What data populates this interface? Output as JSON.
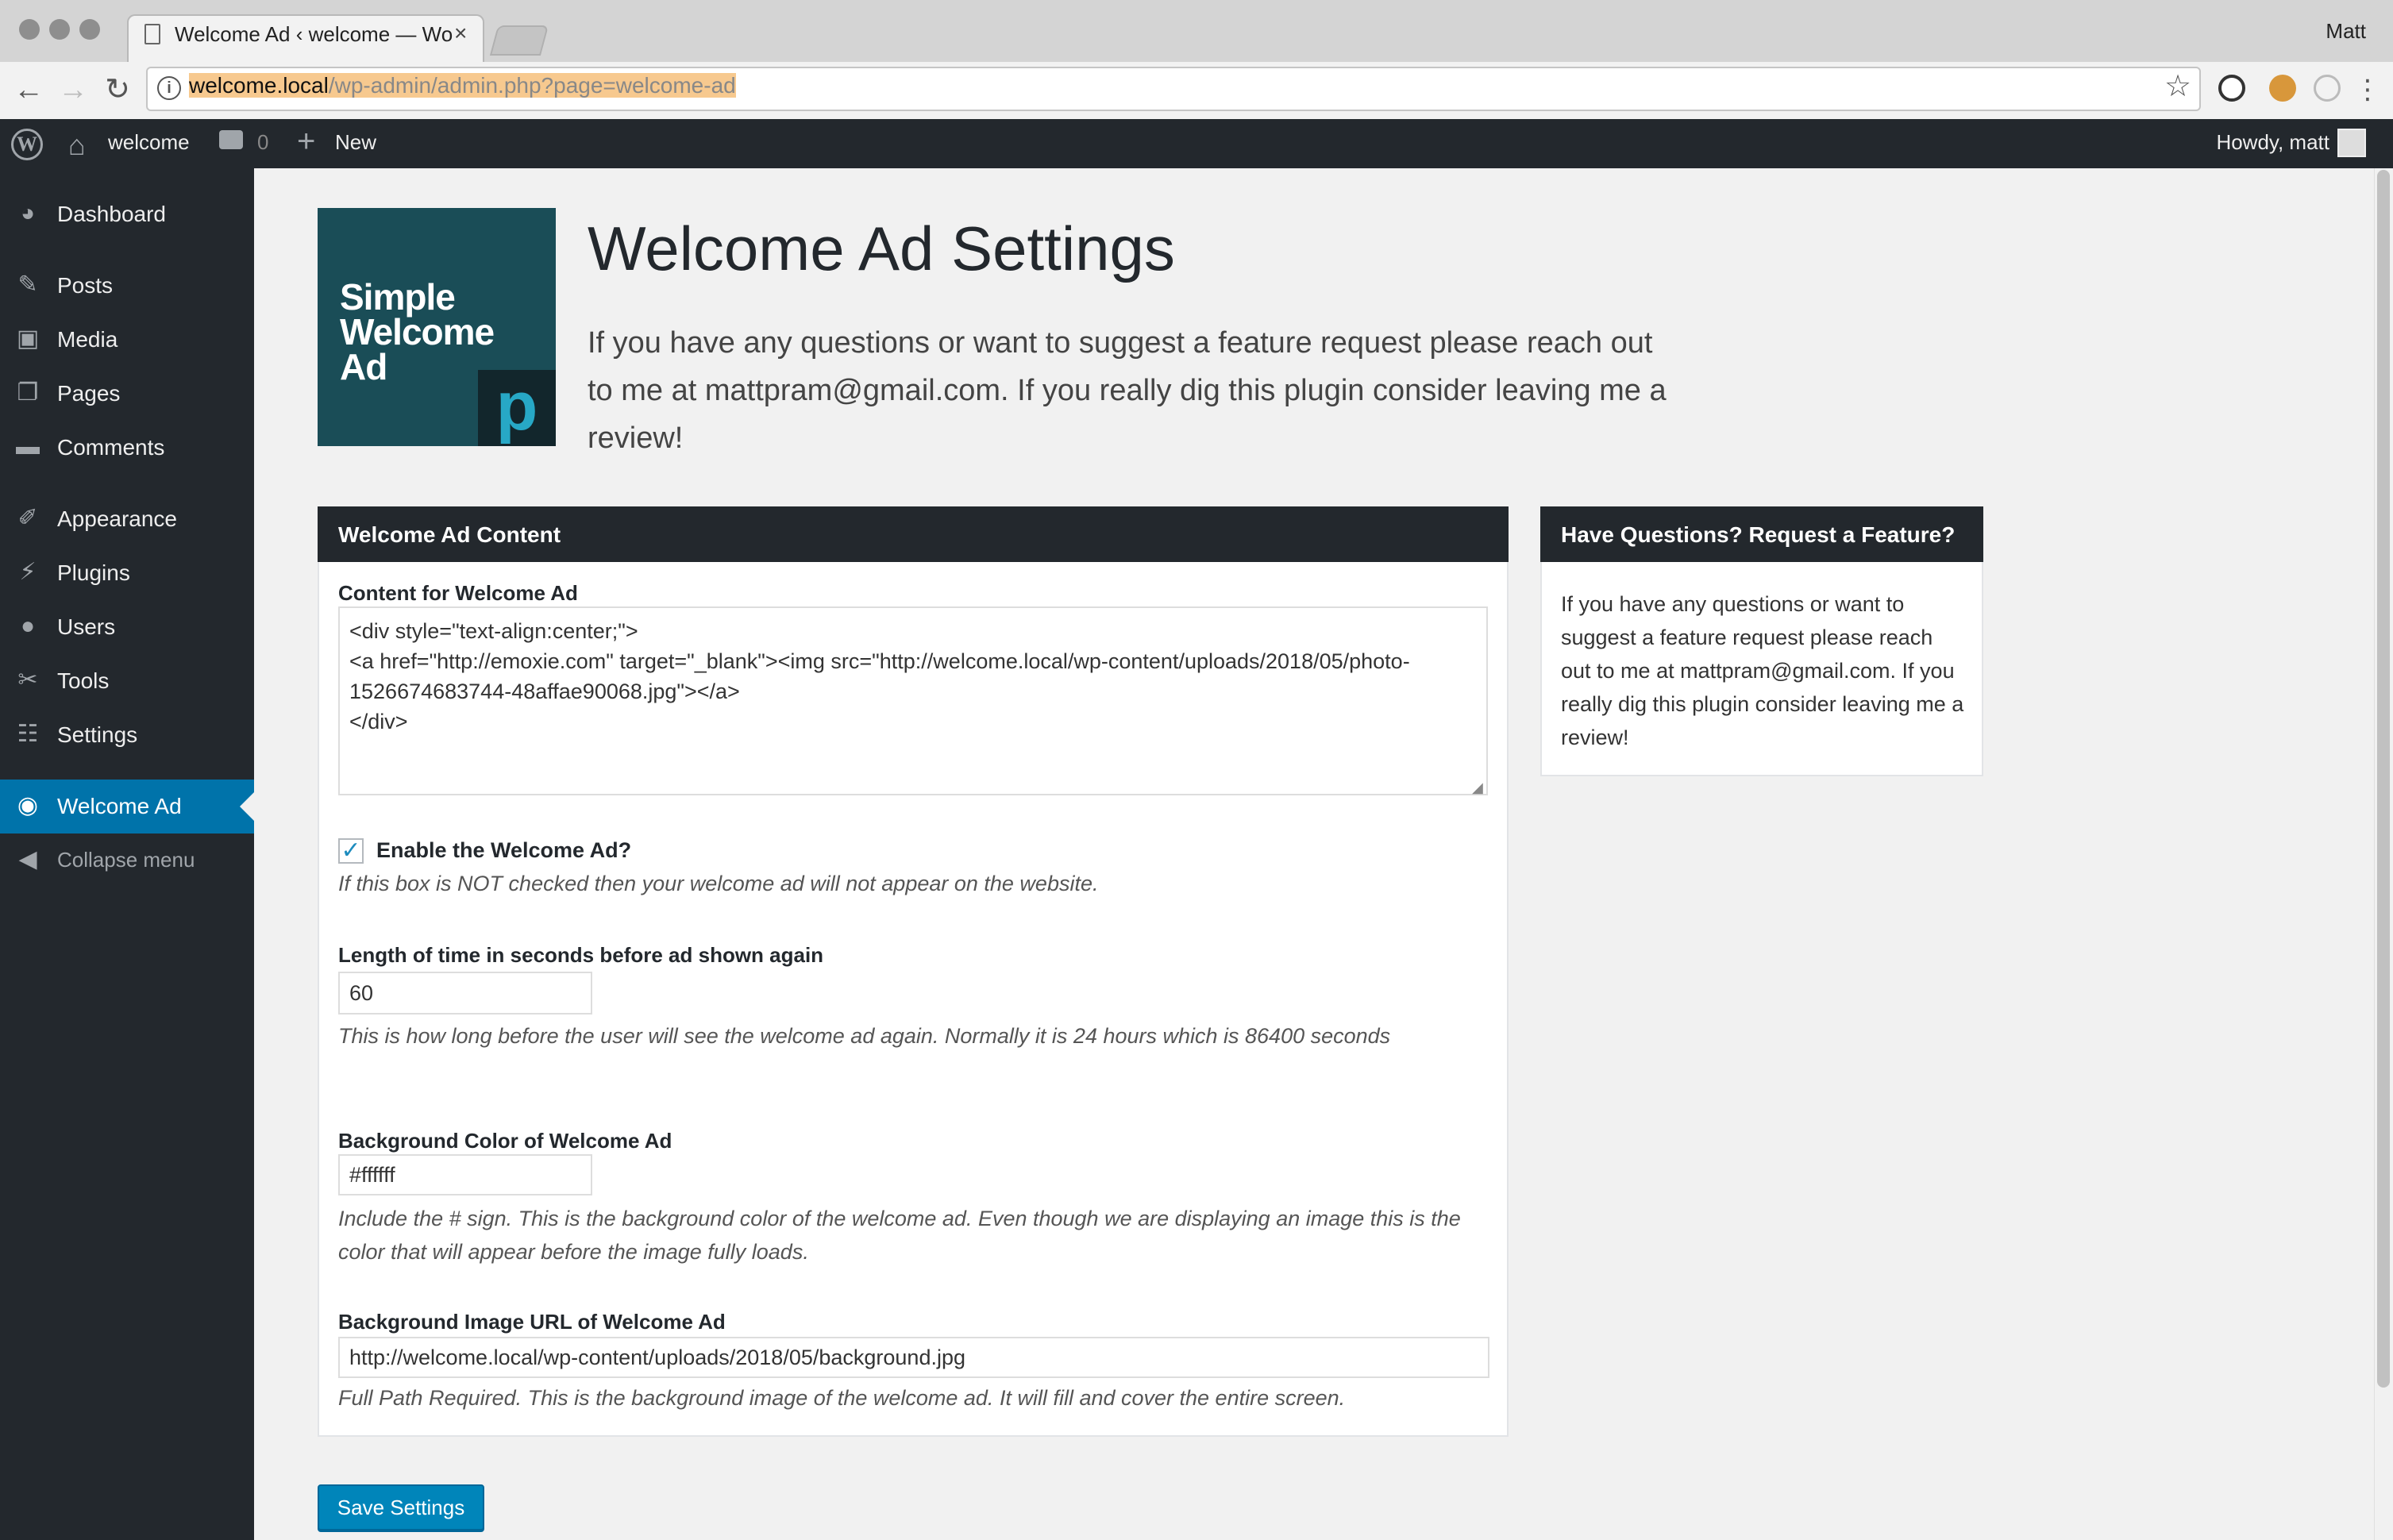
{
  "browser": {
    "tab_title": "Welcome Ad ‹ welcome — WordPress",
    "tab_close": "×",
    "user": "Matt",
    "url_host": "welcome.local",
    "url_path": "/wp-admin/admin.php?page=welcome-ad",
    "back_icon": "←",
    "forward_icon": "→",
    "reload_icon": "↻",
    "star_icon": "☆",
    "menu_icon": "⋮"
  },
  "adminbar": {
    "site_name": "welcome",
    "comment_count": "0",
    "new_label": "New",
    "howdy": "Howdy, matt"
  },
  "sidebar": {
    "items": [
      {
        "label": "Dashboard"
      },
      {
        "label": "Posts"
      },
      {
        "label": "Media"
      },
      {
        "label": "Pages"
      },
      {
        "label": "Comments"
      },
      {
        "label": "Appearance"
      },
      {
        "label": "Plugins"
      },
      {
        "label": "Users"
      },
      {
        "label": "Tools"
      },
      {
        "label": "Settings"
      },
      {
        "label": "Welcome Ad"
      },
      {
        "label": "Collapse menu"
      }
    ]
  },
  "logo": {
    "text_line1": "Simple",
    "text_line2": "Welcome",
    "text_line3": "Ad",
    "badge": "p"
  },
  "main": {
    "title": "Welcome Ad Settings",
    "intro": "If you have any questions or want to suggest a feature request please reach out to me at mattpram@gmail.com. If you really dig this plugin consider leaving me a review!"
  },
  "content_box": {
    "heading": "Welcome Ad Content",
    "content_label": "Content for Welcome Ad",
    "content_value": "<div style=\"text-align:center;\">\n<a href=\"http://emoxie.com\" target=\"_blank\"><img src=\"http://welcome.local/wp-content/uploads/2018/05/photo-1526674683744-48affae90068.jpg\"></a>\n</div>",
    "enable_label": "Enable the Welcome Ad?",
    "enable_checked": true,
    "enable_desc": "If this box is NOT checked then your welcome ad will not appear on the website.",
    "seconds_label": "Length of time in seconds before ad shown again",
    "seconds_value": "60",
    "seconds_desc": "This is how long before the user will see the welcome ad again. Normally it is 24 hours which is 86400 seconds",
    "color_label": "Background Color of Welcome Ad",
    "color_value": "#ffffff",
    "color_desc": "Include the # sign. This is the background color of the welcome ad. Even though we are displaying an image this is the color that will appear before the image fully loads.",
    "image_label": "Background Image URL of Welcome Ad",
    "image_value": "http://welcome.local/wp-content/uploads/2018/05/background.jpg",
    "image_desc": "Full Path Required. This is the background image of the welcome ad. It will fill and cover the entire screen."
  },
  "side_box": {
    "heading": "Have Questions? Request a Feature?",
    "text": "If you have any questions or want to suggest a feature request please reach out to me at mattpram@gmail.com. If you really dig this plugin consider leaving me a review!"
  },
  "save_label": "Save Settings",
  "colors": {
    "admin_dark": "#23282d",
    "accent_blue": "#0073aa",
    "button_blue": "#0085ba"
  }
}
